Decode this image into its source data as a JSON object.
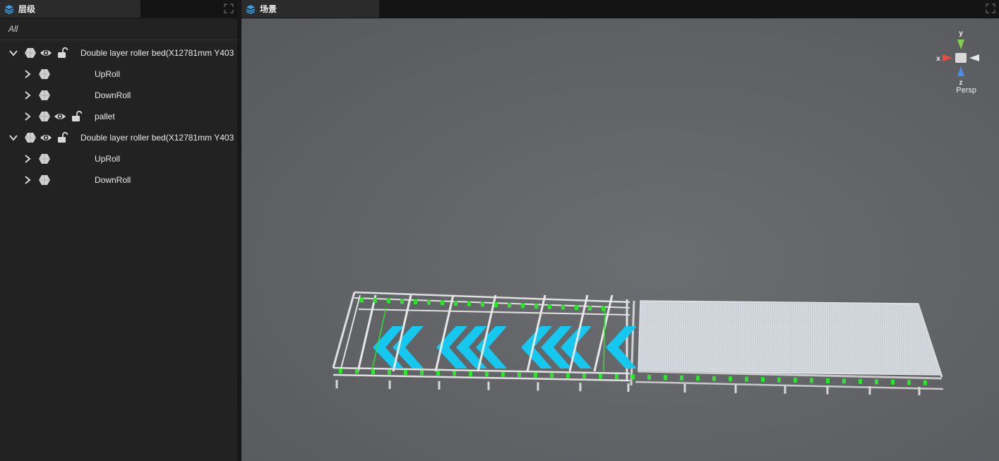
{
  "hierarchy_tab": {
    "title": "层级"
  },
  "scene_tab": {
    "title": "场景"
  },
  "hierarchy": {
    "filter_label": "All",
    "items": [
      {
        "label": "Double layer roller bed(X12781mm Y403",
        "level": 0,
        "expanded": true,
        "show_eye": true,
        "show_lock": true
      },
      {
        "label": "UpRoll",
        "level": 1,
        "expanded": false,
        "show_eye": false,
        "show_lock": false
      },
      {
        "label": "DownRoll",
        "level": 1,
        "expanded": false,
        "show_eye": false,
        "show_lock": false
      },
      {
        "label": "pallet",
        "level": 1,
        "expanded": false,
        "show_eye": true,
        "show_lock": true
      },
      {
        "label": "Double layer roller bed(X12781mm Y403",
        "level": 0,
        "expanded": true,
        "show_eye": true,
        "show_lock": true
      },
      {
        "label": "UpRoll",
        "level": 1,
        "expanded": false,
        "show_eye": false,
        "show_lock": false
      },
      {
        "label": "DownRoll",
        "level": 1,
        "expanded": false,
        "show_eye": false,
        "show_lock": false
      }
    ]
  },
  "viewport": {
    "gizmo": {
      "x_label": "x",
      "y_label": "y",
      "z_label": "z",
      "projection_label": "Persp"
    }
  },
  "colors": {
    "panel_bg": "#222222",
    "viewport_bg": "#626467",
    "accent_blue": "#3aa0e8",
    "arrow_cyan": "#14c8f0",
    "joint_green": "#2ee52e"
  },
  "icons": {
    "hierarchy_tab": "layers-icon",
    "scene_tab": "layers-icon",
    "expand": "chevron-icon",
    "object": "hexagon-cube-icon",
    "visibility": "eye-icon",
    "lock": "unlock-icon",
    "maximize": "maximize-icon"
  }
}
